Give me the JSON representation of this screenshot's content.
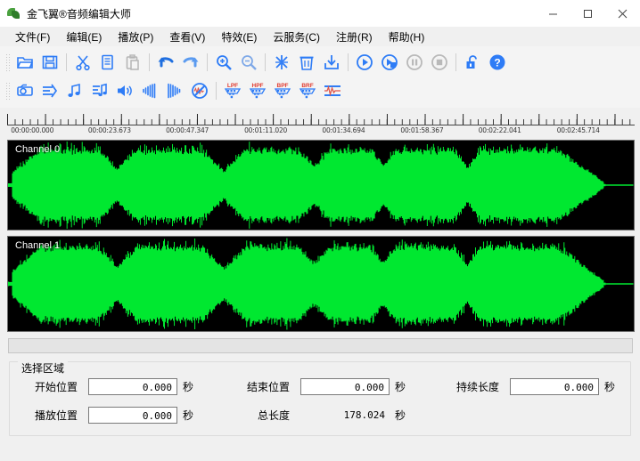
{
  "window": {
    "title": "金飞翼®音频编辑大师",
    "app_icon": "leaf-app-icon",
    "minimize_label": "—",
    "maximize_label": "□",
    "close_label": "✕"
  },
  "menu": {
    "items": [
      {
        "label": "文件(F)",
        "name": "menu-file"
      },
      {
        "label": "编辑(E)",
        "name": "menu-edit"
      },
      {
        "label": "播放(P)",
        "name": "menu-play"
      },
      {
        "label": "查看(V)",
        "name": "menu-view"
      },
      {
        "label": "特效(E)",
        "name": "menu-effects"
      },
      {
        "label": "云服务(C)",
        "name": "menu-cloud"
      },
      {
        "label": "注册(R)",
        "name": "menu-register"
      },
      {
        "label": "帮助(H)",
        "name": "menu-help"
      }
    ]
  },
  "toolbar_row1": [
    {
      "icon": "open-folder-icon",
      "enabled": true
    },
    {
      "icon": "save-icon",
      "enabled": true
    },
    {
      "sep": true
    },
    {
      "icon": "cut-scissors-icon",
      "enabled": true
    },
    {
      "icon": "copy-icon",
      "enabled": true
    },
    {
      "icon": "paste-icon",
      "enabled": false
    },
    {
      "sep": true
    },
    {
      "icon": "undo-arrow-icon",
      "enabled": true
    },
    {
      "icon": "redo-arrow-icon",
      "enabled": true
    },
    {
      "sep": true
    },
    {
      "icon": "zoom-in-icon",
      "enabled": true
    },
    {
      "icon": "zoom-out-icon",
      "enabled": true
    },
    {
      "sep": true
    },
    {
      "icon": "merge-icon",
      "enabled": true
    },
    {
      "icon": "trash-delete-icon",
      "enabled": true
    },
    {
      "icon": "export-down-icon",
      "enabled": true
    },
    {
      "sep": true
    },
    {
      "icon": "play-icon",
      "enabled": true
    },
    {
      "icon": "play-selection-icon",
      "enabled": true
    },
    {
      "icon": "pause-icon",
      "enabled": false
    },
    {
      "icon": "stop-icon",
      "enabled": false
    },
    {
      "sep": true
    },
    {
      "icon": "unlock-icon",
      "enabled": true
    },
    {
      "icon": "help-question-icon",
      "enabled": true
    }
  ],
  "toolbar_row2": [
    {
      "icon": "record-icon",
      "enabled": true
    },
    {
      "icon": "convert-icon",
      "enabled": true
    },
    {
      "icon": "music-note-icon",
      "enabled": true
    },
    {
      "icon": "music-edit-icon",
      "enabled": true
    },
    {
      "icon": "volume-icon",
      "enabled": true
    },
    {
      "icon": "fade-in-icon",
      "enabled": true
    },
    {
      "icon": "fade-out-icon",
      "enabled": true
    },
    {
      "icon": "noise-remove-icon",
      "enabled": true
    },
    {
      "sep": true
    },
    {
      "icon": "lpf-filter-icon",
      "label": "LPF",
      "enabled": true
    },
    {
      "icon": "hpf-filter-icon",
      "label": "HPF",
      "enabled": true
    },
    {
      "icon": "bpf-filter-icon",
      "label": "BPF",
      "enabled": true
    },
    {
      "icon": "brf-filter-icon",
      "label": "BRF",
      "enabled": true
    },
    {
      "icon": "normalize-icon",
      "enabled": true
    }
  ],
  "ruler": {
    "labels": [
      {
        "text": "00:00:00.000",
        "pos_pct": 0.6
      },
      {
        "text": "00:00:23.673",
        "pos_pct": 12.9
      },
      {
        "text": "00:00:47.347",
        "pos_pct": 25.3
      },
      {
        "text": "00:01:11.020",
        "pos_pct": 37.8
      },
      {
        "text": "00:01:34.694",
        "pos_pct": 50.2
      },
      {
        "text": "00:01:58.367",
        "pos_pct": 62.7
      },
      {
        "text": "00:02:22.041",
        "pos_pct": 75.1
      },
      {
        "text": "00:02:45.714",
        "pos_pct": 87.6
      }
    ]
  },
  "waveform": {
    "channels": [
      {
        "label": "Channel 0",
        "name": "waveform-channel-0"
      },
      {
        "label": "Channel 1",
        "name": "waveform-channel-1"
      }
    ],
    "wave_color": "#00e830",
    "background_color": "#000000"
  },
  "selection_group": {
    "title": "选择区域",
    "fields": [
      {
        "label": "开始位置",
        "value": "0.000",
        "unit": "秒",
        "name": "start-position",
        "editable": true
      },
      {
        "label": "结束位置",
        "value": "0.000",
        "unit": "秒",
        "name": "end-position",
        "editable": true
      },
      {
        "label": "持续长度",
        "value": "0.000",
        "unit": "秒",
        "name": "duration-length",
        "editable": true
      },
      {
        "label": "播放位置",
        "value": "0.000",
        "unit": "秒",
        "name": "play-position",
        "editable": true
      },
      {
        "label": "总长度",
        "value": "178.024",
        "unit": "秒",
        "name": "total-length",
        "editable": false
      }
    ]
  }
}
